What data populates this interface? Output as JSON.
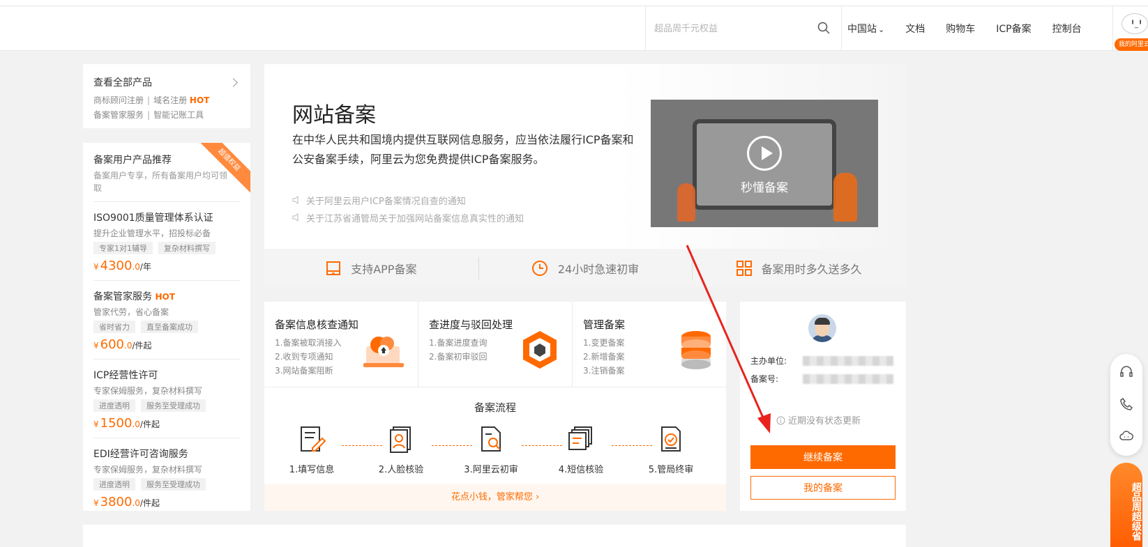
{
  "header": {
    "search_placeholder": "超品周千元权益",
    "nav": [
      "中国站",
      "文档",
      "购物车",
      "ICP备案",
      "控制台"
    ],
    "user_badge": "我的阿里云"
  },
  "all_products": {
    "title": "查看全部产品",
    "links_row1": [
      "商标顾问注册",
      "域名注册"
    ],
    "hot": "HOT",
    "links_row2": [
      "备案管家服务",
      "智能记账工具"
    ]
  },
  "recommend": {
    "ribbon": "超值权益",
    "title": "备案用户产品推荐",
    "desc": "备案用户专享，所有备案用户均可领取",
    "products": [
      {
        "name": "ISO9001质量管理体系认证",
        "hot": "",
        "desc": "提升企业管理水平，招投标必备",
        "tags": [
          "专家1对1辅导",
          "复杂材料撰写"
        ],
        "price_int": "4300",
        "price_dec": ".0",
        "unit": "/年"
      },
      {
        "name": "备案管家服务",
        "hot": "HOT",
        "desc": "管家代劳，省心备案",
        "tags": [
          "省时省力",
          "直至备案成功"
        ],
        "price_int": "600",
        "price_dec": ".0",
        "unit": "/件起"
      },
      {
        "name": "ICP经营性许可",
        "hot": "",
        "desc": "专家保姆服务，复杂材料撰写",
        "tags": [
          "进度透明",
          "服务至受理成功"
        ],
        "price_int": "1500",
        "price_dec": ".0",
        "unit": "/件起"
      },
      {
        "name": "EDI经营许可咨询服务",
        "hot": "",
        "desc": "专家保姆服务，复杂材料撰写",
        "tags": [
          "进度透明",
          "服务至受理成功"
        ],
        "price_int": "3800",
        "price_dec": ".0",
        "unit": "/件起"
      }
    ],
    "currency": "¥"
  },
  "hero": {
    "title": "网站备案",
    "desc": "在中华人民共和国境内提供互联网信息服务，应当依法履行ICP备案和公安备案手续，阿里云为您免费提供ICP备案服务。",
    "notices": [
      "关于阿里云用户ICP备案情况自查的通知",
      "关于江苏省通管局关于加强网站备案信息真实性的通知"
    ],
    "video_label": "秒懂备案",
    "features": [
      "支持APP备案",
      "24小时急速初审",
      "备案用时多久送多久"
    ]
  },
  "services": [
    {
      "title": "备案信息核查通知",
      "lines": [
        "1.备案被取消接入",
        "2.收到专项通知",
        "3.网站备案阻断"
      ]
    },
    {
      "title": "查进度与驳回处理",
      "lines": [
        "1.备案进度查询",
        "2.备案初审驳回"
      ]
    },
    {
      "title": "管理备案",
      "lines": [
        "1.变更备案",
        "2.新增备案",
        "3.注销备案"
      ]
    }
  ],
  "flow": {
    "title": "备案流程",
    "steps": [
      "1.填写信息",
      "2.人脸核验",
      "3.阿里云初审",
      "4.短信核验",
      "5.管局终审"
    ],
    "footer": "花点小钱，管家帮您 ›"
  },
  "status": {
    "host_label": "主办单位:",
    "record_label": "备案号:",
    "no_update": "近期没有状态更新",
    "continue_button": "继续备案",
    "my_button": "我的备案"
  },
  "promo_tab": "超品周超级省",
  "colors": {
    "accent": "#ff6a00",
    "annotation_arrow": "#e8231e"
  }
}
